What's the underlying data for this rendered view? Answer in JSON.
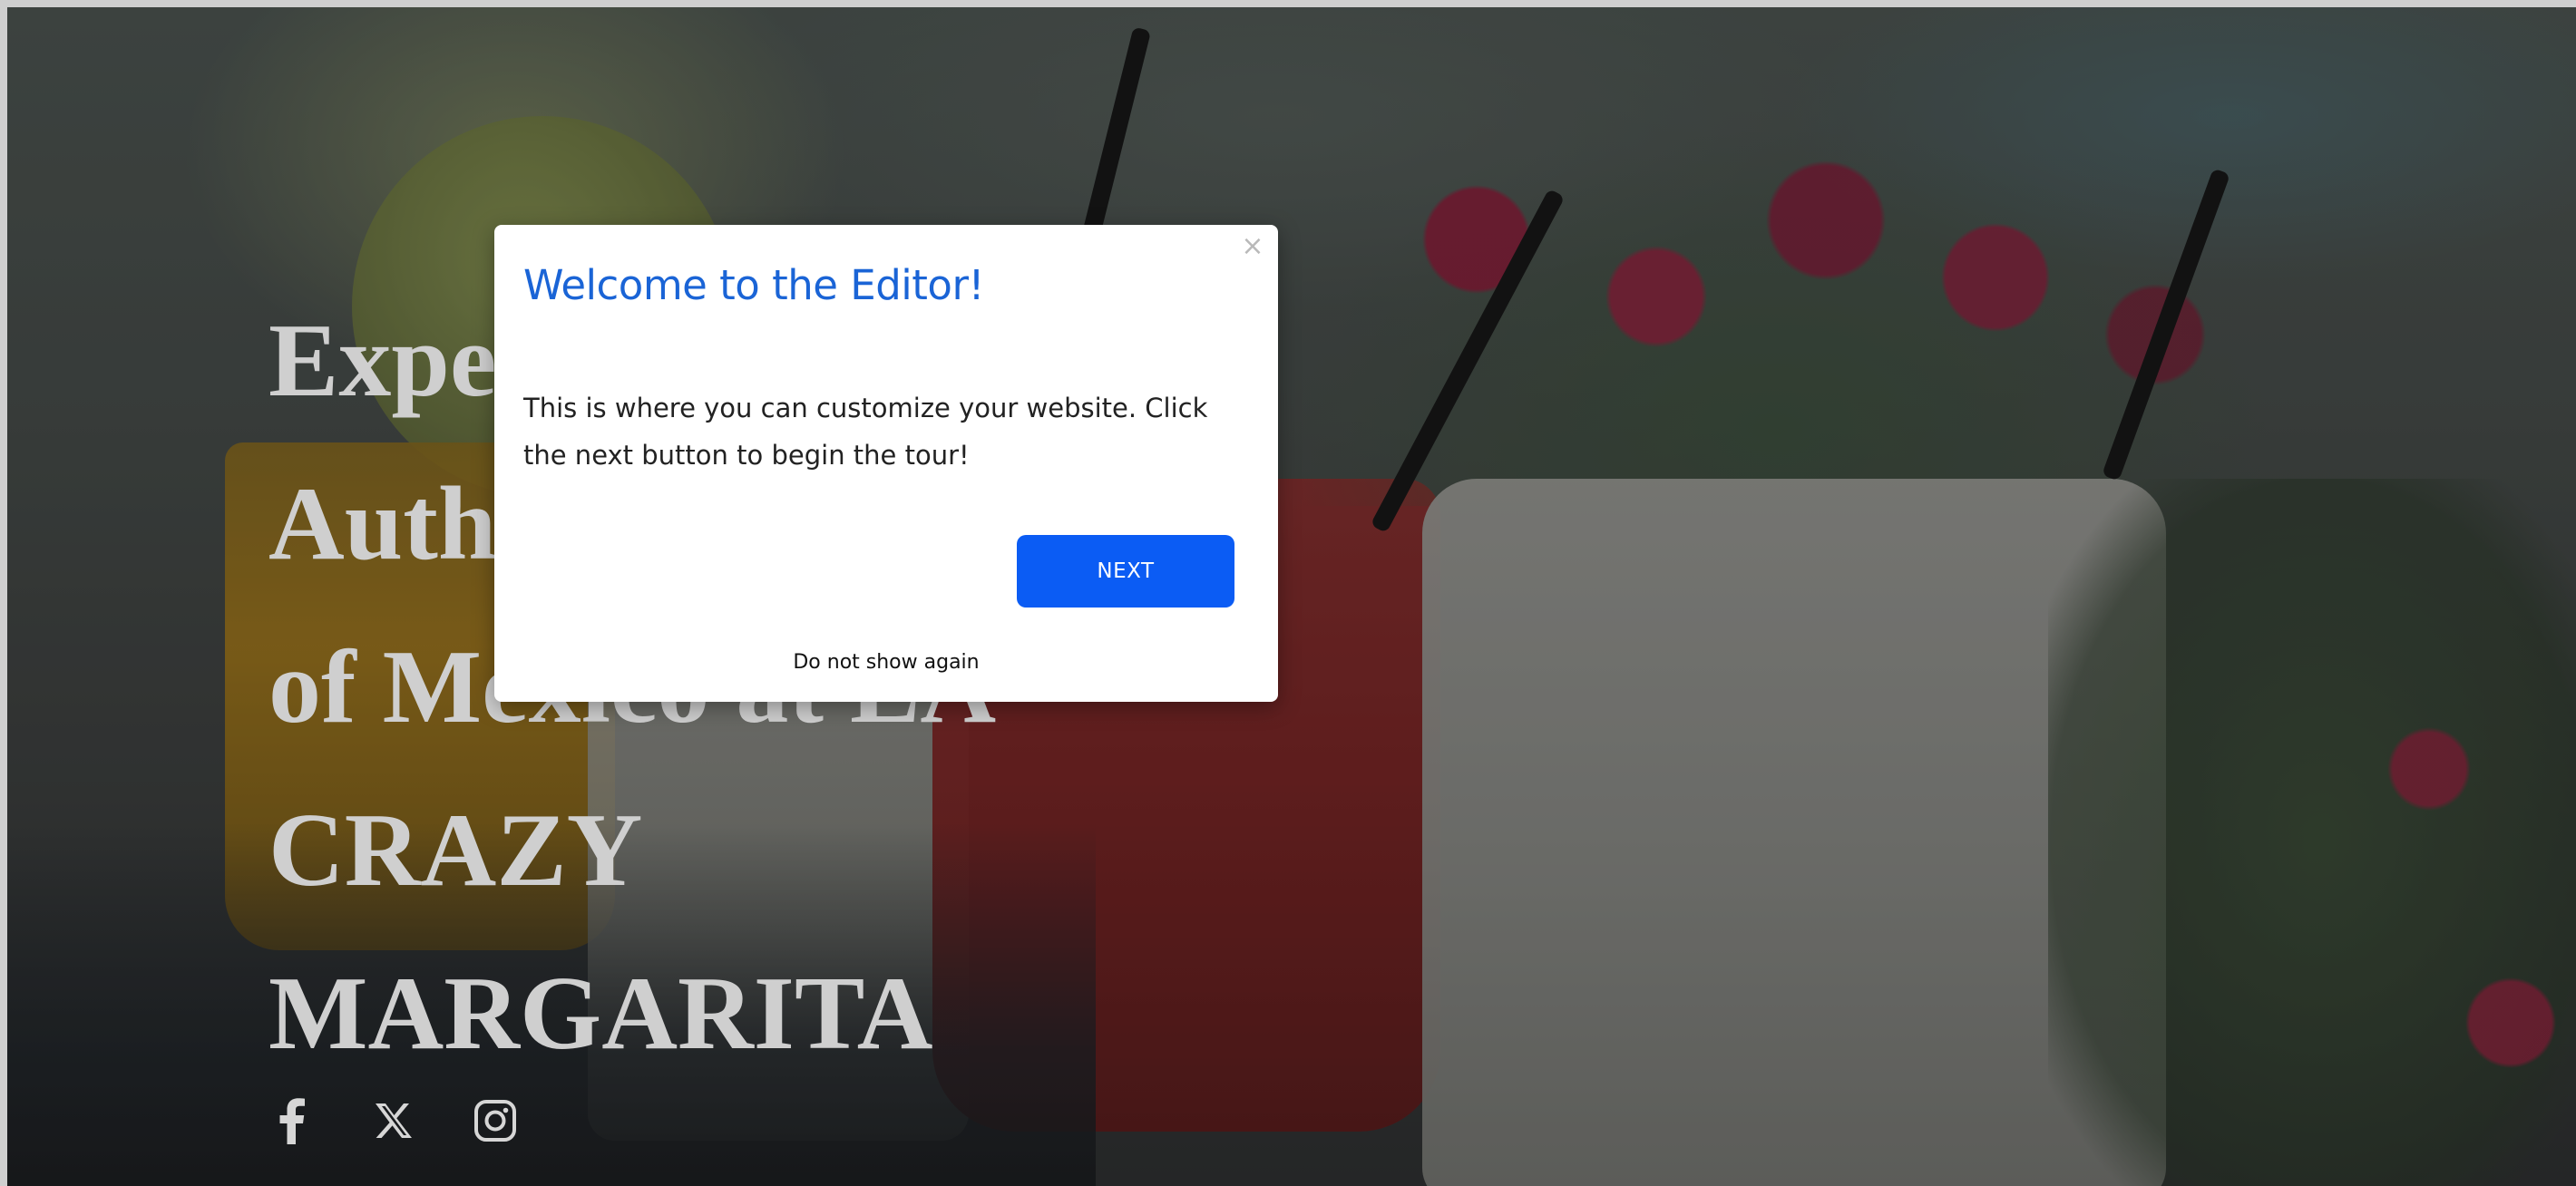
{
  "hero": {
    "lines": [
      "Expe",
      "Auth",
      "of Mexico at LA",
      "CRAZY",
      "MARGARITA"
    ]
  },
  "social": {
    "icons": [
      "facebook-icon",
      "x-twitter-icon",
      "instagram-icon"
    ]
  },
  "modal": {
    "title": "Welcome to the Editor!",
    "close_label": "×",
    "body": "This is where you can customize your website. Click the next button to begin the tour!",
    "next_label": "NEXT",
    "dont_show_label": "Do not show again"
  },
  "colors": {
    "title_blue": "#1a64d6",
    "button_blue": "#0b5cf4",
    "hero_text": "#cfcfcf"
  }
}
